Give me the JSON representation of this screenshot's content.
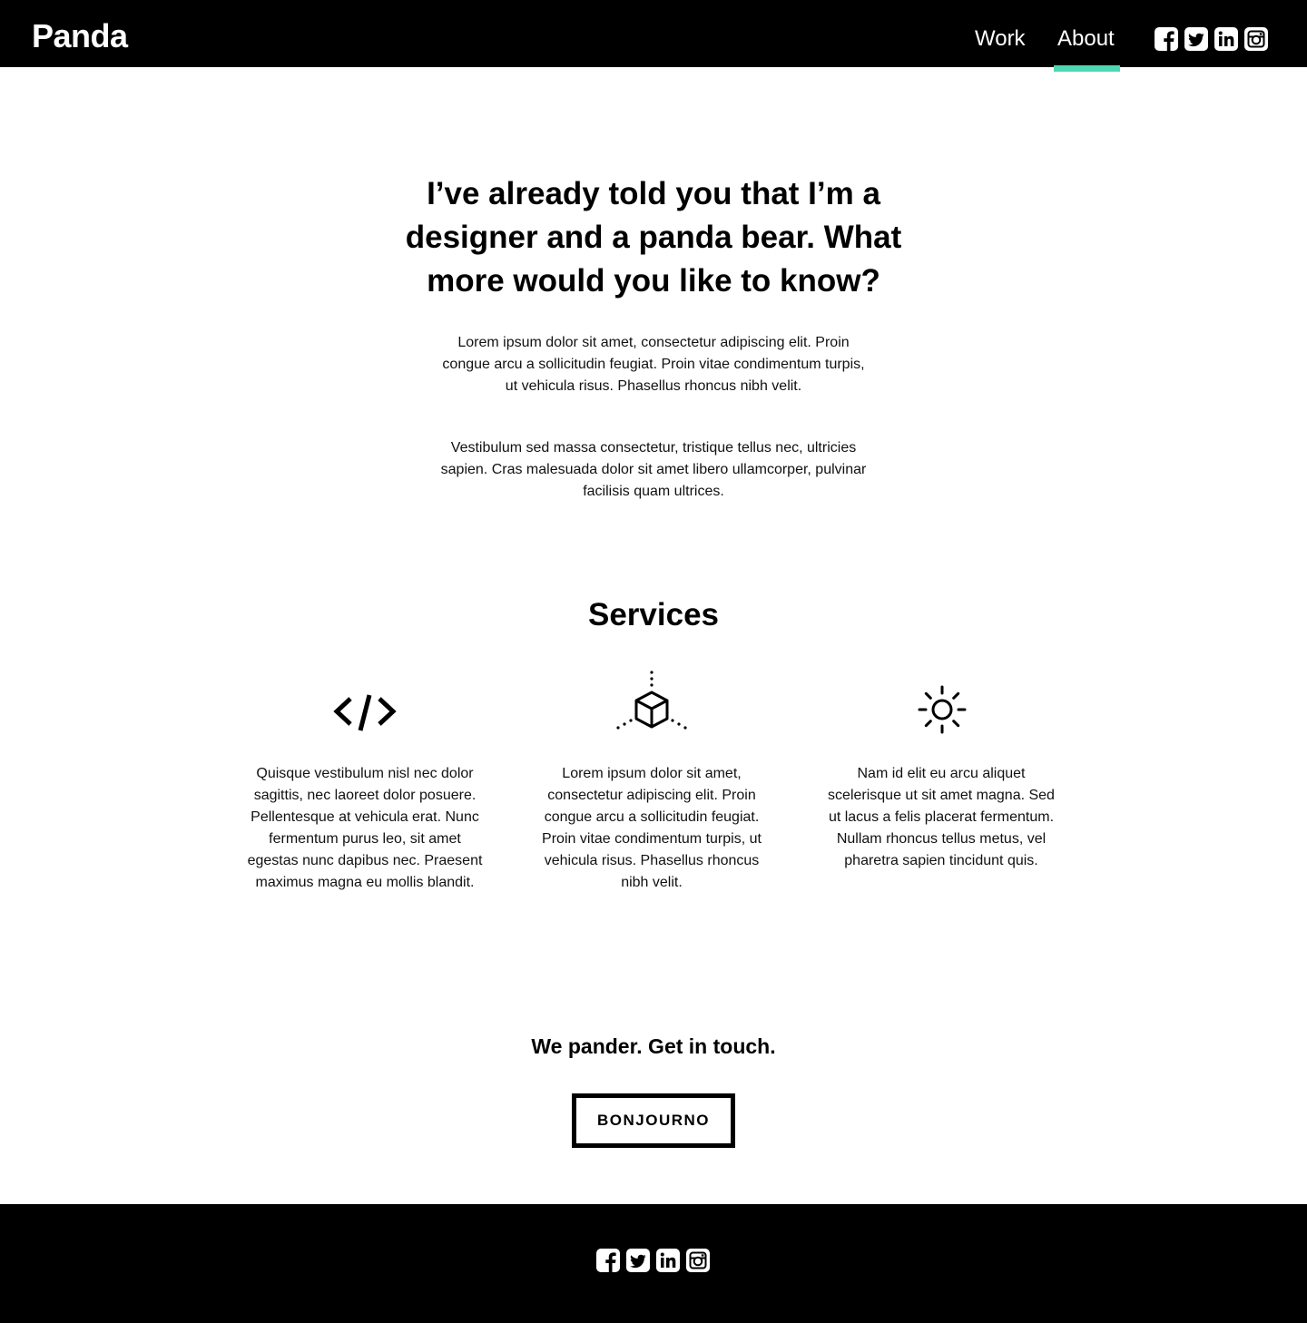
{
  "header": {
    "logo": "Panda",
    "nav": [
      {
        "label": "Work"
      },
      {
        "label": "About",
        "active": true
      }
    ],
    "social_icons": [
      "facebook-icon",
      "twitter-icon",
      "linkedin-icon",
      "instagram-icon"
    ]
  },
  "intro": {
    "headline": "I’ve already told you that I’m a designer and a panda bear. What more would you like to know?",
    "paragraphs": [
      "Lorem ipsum dolor sit amet, consectetur adipiscing elit. Proin congue arcu a sollicitudin feugiat. Proin vitae condimentum turpis, ut vehicula risus. Phasellus rhoncus nibh velit.",
      "Vestibulum sed massa consectetur, tristique tellus nec, ultricies sapien. Cras malesuada dolor sit amet libero ullamcorper, pulvinar facilisis quam ultrices."
    ]
  },
  "services": {
    "title": "Services",
    "items": [
      {
        "icon": "code-icon",
        "text": "Quisque vestibulum nisl nec dolor sagittis, nec laoreet dolor posuere. Pellentesque at vehicula erat. Nunc fermentum purus leo, sit amet egestas nunc dapibus nec. Praesent maximus magna eu mollis blandit."
      },
      {
        "icon": "cube-icon",
        "text": "Lorem ipsum dolor sit amet, consectetur adipiscing elit. Proin congue arcu a sollicitudin feugiat. Proin vitae condimentum turpis, ut vehicula risus. Phasellus rhoncus nibh velit."
      },
      {
        "icon": "sun-icon",
        "text": "Nam id elit eu arcu aliquet scelerisque ut sit amet magna. Sed ut lacus a felis placerat fermentum. Nullam rhoncus tellus metus, vel pharetra sapien tincidunt quis."
      }
    ]
  },
  "cta": {
    "title": "We pander. Get in touch.",
    "button_label": "BONJOURNO"
  },
  "footer": {
    "social_icons": [
      "facebook-icon",
      "twitter-icon",
      "linkedin-icon",
      "instagram-icon"
    ]
  },
  "colors": {
    "accent": "#4ed8b1",
    "header_bg": "#000000",
    "footer_bg": "#000000",
    "text": "#000000"
  }
}
